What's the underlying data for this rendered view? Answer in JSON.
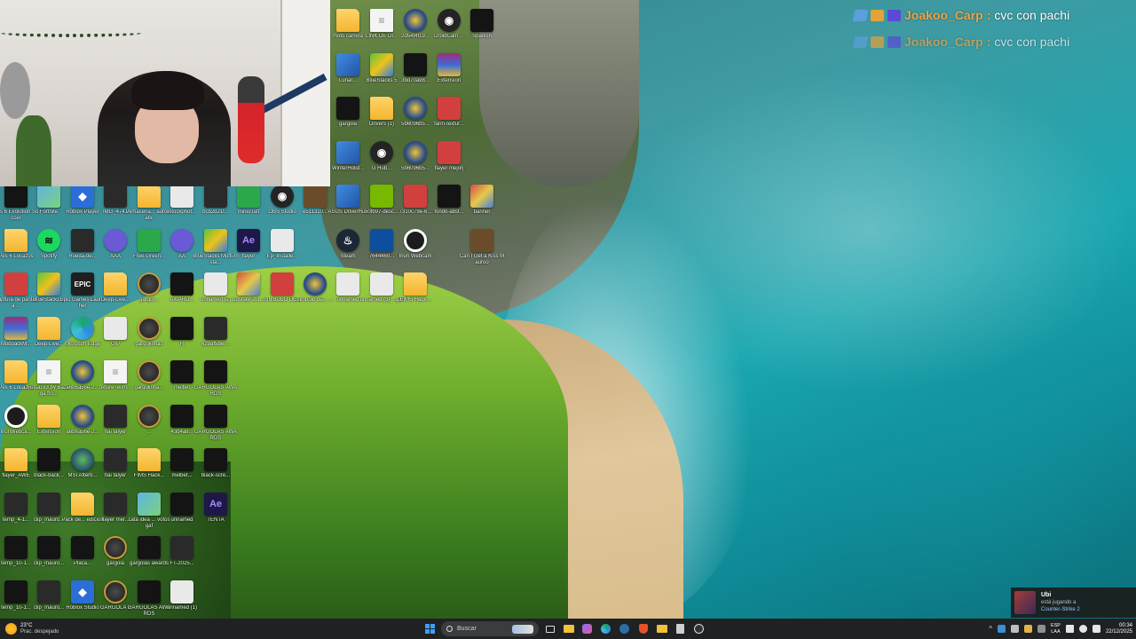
{
  "chat": [
    {
      "user": "Joakoo_Carp",
      "message": "cvc con pachi"
    },
    {
      "user": "Joakoo_Carp",
      "message": "cvc con pachi"
    }
  ],
  "desktop_icons": [
    {
      "label": "Pes 6 Evolution Soccer",
      "glyph": "g-dark",
      "col": 0,
      "row": 0
    },
    {
      "label": "Fortnite",
      "glyph": "g-gallery",
      "col": 1,
      "row": 0
    },
    {
      "label": "Roblox Player",
      "glyph": "g-roblox",
      "col": 2,
      "row": 0
    },
    {
      "label": "IMG_4741",
      "glyph": "g-dark2",
      "col": 3,
      "row": 0
    },
    {
      "label": "Almacena... automatic",
      "glyph": "g-folder",
      "col": 4,
      "row": 0
    },
    {
      "label": "istockphot...",
      "glyph": "g-white-image",
      "col": 5,
      "row": 0
    },
    {
      "label": "bcb2d21f...",
      "glyph": "g-dark2",
      "col": 6,
      "row": 0
    },
    {
      "label": "minecraft",
      "glyph": "g-green",
      "col": 7,
      "row": 0
    },
    {
      "label": "OBS Studio",
      "glyph": "g-obs",
      "col": 8,
      "row": 0
    },
    {
      "label": "e511310...",
      "glyph": "g-brown",
      "col": 9,
      "row": 0
    },
    {
      "label": "Pes 6 Locazos",
      "glyph": "g-folder",
      "col": 0,
      "row": 1
    },
    {
      "label": "Spotify",
      "glyph": "g-spotify",
      "col": 1,
      "row": 1
    },
    {
      "label": "Rueda-de...",
      "glyph": "g-dark2",
      "col": 2,
      "row": 1
    },
    {
      "label": "AAA",
      "glyph": "g-ubi",
      "col": 3,
      "row": 1
    },
    {
      "label": "Free-Green...",
      "glyph": "g-green",
      "col": 4,
      "row": 1
    },
    {
      "label": "AA",
      "glyph": "g-ubi",
      "col": 5,
      "row": 1
    },
    {
      "label": "BlueStacks Multi-Insta...",
      "glyph": "g-bluestacks",
      "col": 6,
      "row": 1
    },
    {
      "label": "flayer",
      "glyph": "g-ae",
      "col": 7,
      "row": 1
    },
    {
      "label": "Ep_Installe...",
      "glyph": "g-white-image",
      "col": 8,
      "row": 1
    },
    {
      "label": "Captura de pantalla ...",
      "glyph": "g-red",
      "col": 0,
      "row": 2
    },
    {
      "label": "BlueStacks X",
      "glyph": "g-bluestacks",
      "col": 1,
      "row": 2
    },
    {
      "label": "Epic Games Launcher",
      "glyph": "g-epic",
      "col": 2,
      "row": 2
    },
    {
      "label": "Deep-Live...",
      "glyph": "g-folder",
      "col": 3,
      "row": 2
    },
    {
      "label": "gargol...",
      "glyph": "g-gargola",
      "col": 4,
      "row": 2
    },
    {
      "label": "AWARD...",
      "glyph": "g-dark",
      "col": 5,
      "row": 2
    },
    {
      "label": "unnamed (2)",
      "glyph": "g-white-image",
      "col": 6,
      "row": 2
    },
    {
      "label": "upscayl-2.1...",
      "glyph": "g-mixed",
      "col": 7,
      "row": 2
    },
    {
      "label": "SIMBOLO DE...",
      "glyph": "g-red",
      "col": 8,
      "row": 2
    },
    {
      "label": "simbolo de... ...",
      "glyph": "g-csgo",
      "col": 9,
      "row": 2
    },
    {
      "label": "ModpackM...",
      "glyph": "g-winrar",
      "col": 0,
      "row": 3
    },
    {
      "label": "Deep-Live...",
      "glyph": "g-folder",
      "col": 1,
      "row": 3
    },
    {
      "label": "Microsoft Edge",
      "glyph": "g-edge",
      "col": 2,
      "row": 3
    },
    {
      "label": "OIP",
      "glyph": "g-white-image",
      "col": 3,
      "row": 3
    },
    {
      "label": "gargolinhas",
      "glyph": "g-gargola",
      "col": 4,
      "row": 3
    },
    {
      "label": "R",
      "glyph": "g-dark",
      "col": 5,
      "row": 3
    },
    {
      "label": "629af5be-...",
      "glyph": "g-dark2",
      "col": 6,
      "row": 3
    },
    {
      "label": "Pes 6 Locazos",
      "glyph": "g-folder",
      "col": 0,
      "row": 4
    },
    {
      "label": "Futsal x3 by Bazinga fro...",
      "glyph": "g-file",
      "col": 1,
      "row": 4
    },
    {
      "label": "a6b6a56e-2...",
      "glyph": "g-csgo",
      "col": 2,
      "row": 4
    },
    {
      "label": "fixture_elim...",
      "glyph": "g-file",
      "col": 3,
      "row": 4
    },
    {
      "label": "gargolinha...",
      "glyph": "g-gargola",
      "col": 4,
      "row": 4
    },
    {
      "label": "melbet",
      "glyph": "g-dark",
      "col": 5,
      "row": 4
    },
    {
      "label": "GARGOLAS AWARDS",
      "glyph": "g-dark",
      "col": 6,
      "row": 4
    },
    {
      "label": "InunWebca...",
      "glyph": "g-webcam",
      "col": 0,
      "row": 5
    },
    {
      "label": "Extension",
      "glyph": "g-folder",
      "col": 1,
      "row": 5
    },
    {
      "label": "a6b6a56e-2...",
      "glyph": "g-csgo",
      "col": 2,
      "row": 5
    },
    {
      "label": "hai falyer",
      "glyph": "g-dark2",
      "col": 3,
      "row": 5
    },
    {
      "label": "...",
      "glyph": "g-gargola",
      "col": 4,
      "row": 5
    },
    {
      "label": "43d4a8...",
      "glyph": "g-dark",
      "col": 5,
      "row": 5
    },
    {
      "label": "GARGOLAS AWARDS",
      "glyph": "g-dark",
      "col": 6,
      "row": 5
    },
    {
      "label": "flayer_AWE",
      "glyph": "g-folder",
      "col": 0,
      "row": 6
    },
    {
      "label": "black-back...",
      "glyph": "g-dark",
      "col": 1,
      "row": 6
    },
    {
      "label": "MSI Afterb...",
      "glyph": "g-msi",
      "col": 2,
      "row": 6
    },
    {
      "label": "hai falyer",
      "glyph": "g-dark2",
      "col": 3,
      "row": 6
    },
    {
      "label": "FIMS Hack...",
      "glyph": "g-folder",
      "col": 4,
      "row": 6
    },
    {
      "label": "melbet...",
      "glyph": "g-dark",
      "col": 5,
      "row": 6
    },
    {
      "label": "black-scre...",
      "glyph": "g-dark",
      "col": 6,
      "row": 6
    },
    {
      "label": "temp_4-1...",
      "glyph": "g-dark2",
      "col": 0,
      "row": 7
    },
    {
      "label": "clip_mauro...",
      "glyph": "g-dark2",
      "col": 1,
      "row": 7
    },
    {
      "label": "Pack de... edicion",
      "glyph": "g-folder",
      "col": 2,
      "row": 7
    },
    {
      "label": "flayer mer...",
      "glyph": "g-dark2",
      "col": 3,
      "row": 7
    },
    {
      "label": "cata idea ... votos gaf",
      "glyph": "g-gallery",
      "col": 4,
      "row": 7
    },
    {
      "label": "unnamed",
      "glyph": "g-dark",
      "col": 5,
      "row": 7
    },
    {
      "label": "TENTA",
      "glyph": "g-ae",
      "col": 6,
      "row": 7
    },
    {
      "label": "temp_10-1...",
      "glyph": "g-dark",
      "col": 0,
      "row": 8
    },
    {
      "label": "clip_mauro...",
      "glyph": "g-dark",
      "col": 1,
      "row": 8
    },
    {
      "label": "Placa...",
      "glyph": "g-dark",
      "col": 2,
      "row": 8
    },
    {
      "label": "gargola",
      "glyph": "g-gargola",
      "col": 3,
      "row": 8
    },
    {
      "label": "gargolas awards",
      "glyph": "g-dark",
      "col": 4,
      "row": 8
    },
    {
      "label": "FT-2025...",
      "glyph": "g-dark2",
      "col": 5,
      "row": 8
    },
    {
      "label": "temp_10-1...",
      "glyph": "g-dark",
      "col": 0,
      "row": 9
    },
    {
      "label": "clip_mauro...",
      "glyph": "g-dark2",
      "col": 1,
      "row": 9
    },
    {
      "label": "Roblox Studio",
      "glyph": "g-roblox",
      "col": 2,
      "row": 9
    },
    {
      "label": "GARGOLA 2",
      "glyph": "g-gargola",
      "col": 3,
      "row": 9
    },
    {
      "label": "GARGOLAS AWARDS",
      "glyph": "g-dark",
      "col": 4,
      "row": 9
    },
    {
      "label": "unnamed (1)",
      "glyph": "g-white-image",
      "col": 5,
      "row": 9
    },
    {
      "label": "moto carrera",
      "glyph": "g-folder",
      "col": 10,
      "row": -4
    },
    {
      "label": "LINK DE DI...",
      "glyph": "g-file",
      "col": 11,
      "row": -4
    },
    {
      "label": "2d54f4f19...",
      "glyph": "g-csgo",
      "col": 12,
      "row": -4
    },
    {
      "label": "DroidCam ...",
      "glyph": "g-obs",
      "col": 13,
      "row": -4
    },
    {
      "label": "Spanish",
      "glyph": "g-dark",
      "col": 14,
      "row": -4
    },
    {
      "label": "Lunar...",
      "glyph": "g-exe",
      "col": 10,
      "row": -3
    },
    {
      "label": "BlueStacks 5",
      "glyph": "g-bluestacks",
      "col": 11,
      "row": -3
    },
    {
      "label": "3bd70a98...",
      "glyph": "g-dark",
      "col": 12,
      "row": -3
    },
    {
      "label": "Extension",
      "glyph": "g-winrar",
      "col": 13,
      "row": -3
    },
    {
      "label": "gargola",
      "glyph": "g-dark",
      "col": 10,
      "row": -2
    },
    {
      "label": "Drivers (1)",
      "glyph": "g-folder",
      "col": 11,
      "row": -2
    },
    {
      "label": "5b6096b5...",
      "glyph": "g-csgo",
      "col": 12,
      "row": -2
    },
    {
      "label": "farm-textur...",
      "glyph": "g-red",
      "col": 13,
      "row": -2
    },
    {
      "label": "WinterHolid...",
      "glyph": "g-exe",
      "col": 10,
      "row": -1
    },
    {
      "label": "G Hub...",
      "glyph": "g-obs",
      "col": 11,
      "row": -1
    },
    {
      "label": "5b6096b5...",
      "glyph": "g-csgo",
      "col": 12,
      "row": -1
    },
    {
      "label": "flayer mejorj",
      "glyph": "g-red",
      "col": 13,
      "row": -1
    },
    {
      "label": "ASUS DriverHub",
      "glyph": "g-exe",
      "col": 10,
      "row": 0
    },
    {
      "label": "50fb97-desc...",
      "glyph": "g-nvidia",
      "col": 11,
      "row": 0
    },
    {
      "label": "7310c79e-6...",
      "glyph": "g-red",
      "col": 12,
      "row": 0
    },
    {
      "label": "fondo-abst...",
      "glyph": "g-dark",
      "col": 13,
      "row": 0
    },
    {
      "label": "banner",
      "glyph": "g-mixed",
      "col": 14,
      "row": 0
    },
    {
      "label": "Steam",
      "glyph": "g-steam",
      "col": 10,
      "row": 1
    },
    {
      "label": "7644460...",
      "glyph": "g-ps",
      "col": 11,
      "row": 1
    },
    {
      "label": "Iriun Webcam",
      "glyph": "g-webcam",
      "col": 12,
      "row": 1
    },
    {
      "label": "Can I Get a Kiss Mauroo",
      "glyph": "g-brown",
      "col": 14,
      "row": 1
    },
    {
      "label": "unnamed",
      "glyph": "g-white-image",
      "col": 10,
      "row": 2
    },
    {
      "label": "unnamed (3) ...gaf",
      "glyph": "g-white-image",
      "col": 11,
      "row": 2
    },
    {
      "label": "FIMS Hack...",
      "glyph": "g-folder",
      "col": 12,
      "row": 2
    }
  ],
  "notification": {
    "name": "Ubi",
    "status": "está jugando a",
    "game": "Counter-Strike 2"
  },
  "taskbar": {
    "weather_temp": "23°C",
    "weather_desc": "Prac. despejado",
    "search_placeholder": "Buscar",
    "pinned_apps": [
      "task-view",
      "file-explorer",
      "teams",
      "edge",
      "steam",
      "brave",
      "folder",
      "calculator",
      "obs"
    ],
    "lang_line1": "ESP",
    "lang_line2": "LAA",
    "time": "00:34",
    "date": "22/12/2025"
  }
}
